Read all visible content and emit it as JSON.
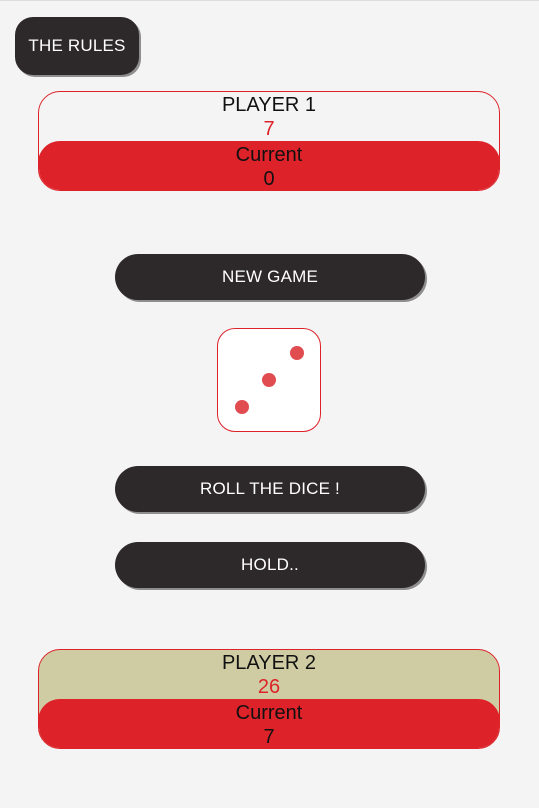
{
  "rules_button": {
    "label": "THE RULES"
  },
  "player1": {
    "name": "PLAYER 1",
    "score": "7",
    "current_label": "Current",
    "current_value": "0",
    "panel_color": "#f4f4f4"
  },
  "new_game_button": {
    "label": "NEW GAME"
  },
  "dice": {
    "value": 3,
    "icon": "dice-three-icon",
    "pip_color": "#e04c50"
  },
  "roll_button": {
    "label": "ROLL THE DICE !"
  },
  "hold_button": {
    "label": "HOLD.."
  },
  "player2": {
    "name": "PLAYER 2",
    "score": "26",
    "current_label": "Current",
    "current_value": "7",
    "panel_color": "#cfcca3"
  },
  "colors": {
    "accent": "#dd2229",
    "button_bg": "#2d2829",
    "background": "#f4f4f4"
  }
}
